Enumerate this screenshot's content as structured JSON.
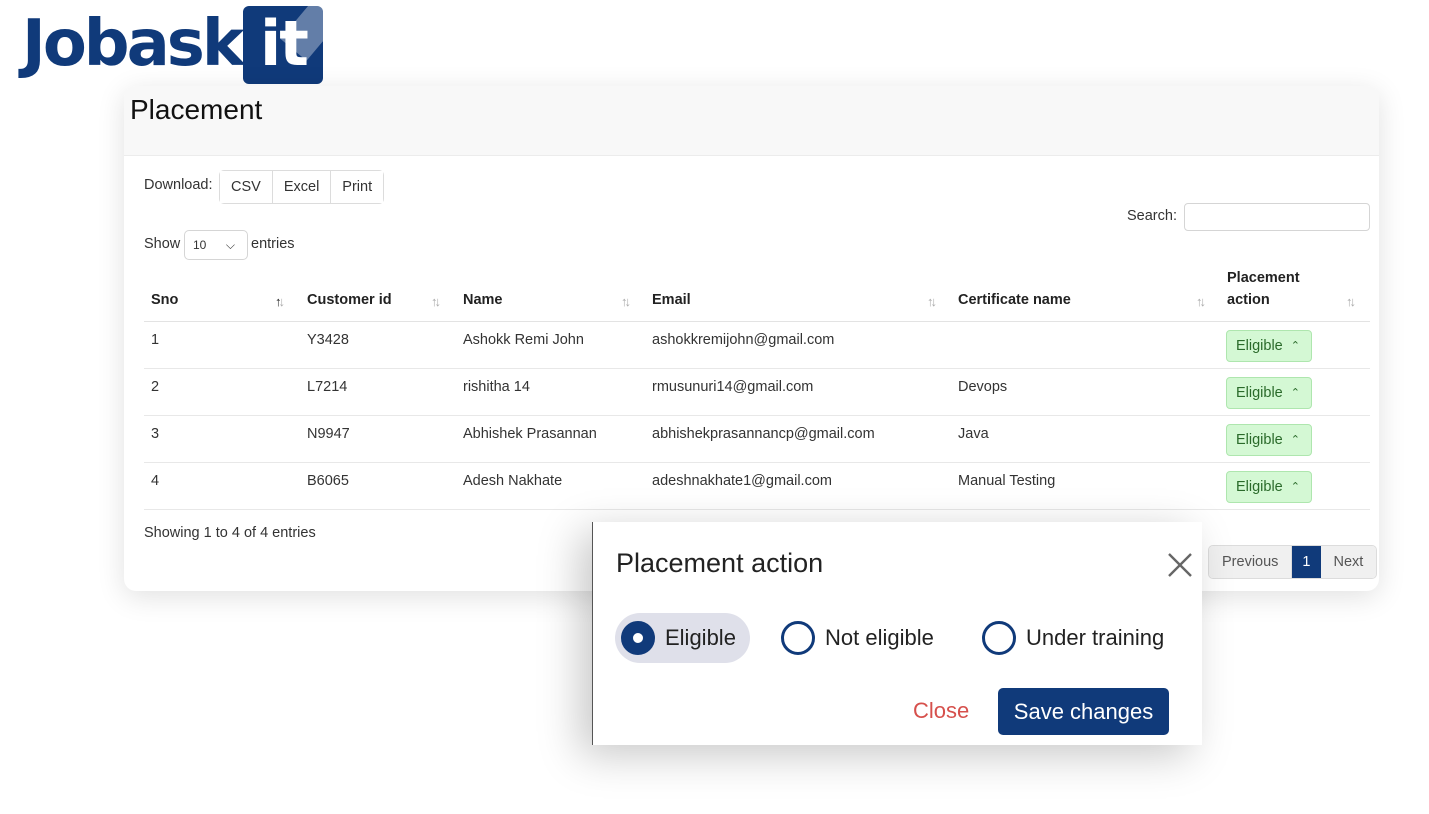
{
  "logo": {
    "text_main": "Jobask",
    "text_box": "it"
  },
  "page": {
    "title": "Placement"
  },
  "download": {
    "label": "Download:",
    "buttons": [
      "CSV",
      "Excel",
      "Print"
    ]
  },
  "search": {
    "label": "Search:",
    "value": "",
    "placeholder": ""
  },
  "length": {
    "show_label": "Show",
    "selected": "10",
    "entries_label": "entries"
  },
  "table": {
    "columns": [
      "Sno",
      "Customer id",
      "Name",
      "Email",
      "Certificate name",
      "Placement action"
    ],
    "sorted_column": "Sno",
    "rows": [
      {
        "sno": "1",
        "customer_id": "Y3428",
        "name": "Ashokk Remi John",
        "email": "ashokkremijohn@gmail.com",
        "certificate": "",
        "action": "Eligible"
      },
      {
        "sno": "2",
        "customer_id": "L7214",
        "name": "rishitha 14",
        "email": "rmusunuri14@gmail.com",
        "certificate": "Devops",
        "action": "Eligible"
      },
      {
        "sno": "3",
        "customer_id": "N9947",
        "name": "Abhishek Prasannan",
        "email": "abhishekprasannancp@gmail.com",
        "certificate": "Java",
        "action": "Eligible"
      },
      {
        "sno": "4",
        "customer_id": "B6065",
        "name": "Adesh Nakhate",
        "email": "adeshnakhate1@gmail.com",
        "certificate": "Manual Testing",
        "action": "Eligible"
      }
    ]
  },
  "info": {
    "text": "Showing 1 to 4 of 4 entries"
  },
  "pagination": {
    "previous": "Previous",
    "current": "1",
    "next": "Next"
  },
  "modal": {
    "title": "Placement action",
    "options": [
      "Eligible",
      "Not eligible",
      "Under training"
    ],
    "selected": "Eligible",
    "close_label": "Close",
    "save_label": "Save changes"
  },
  "colors": {
    "brand": "#103a7a",
    "eligible_bg": "#d4f8d4",
    "close_text": "#d6504c"
  }
}
